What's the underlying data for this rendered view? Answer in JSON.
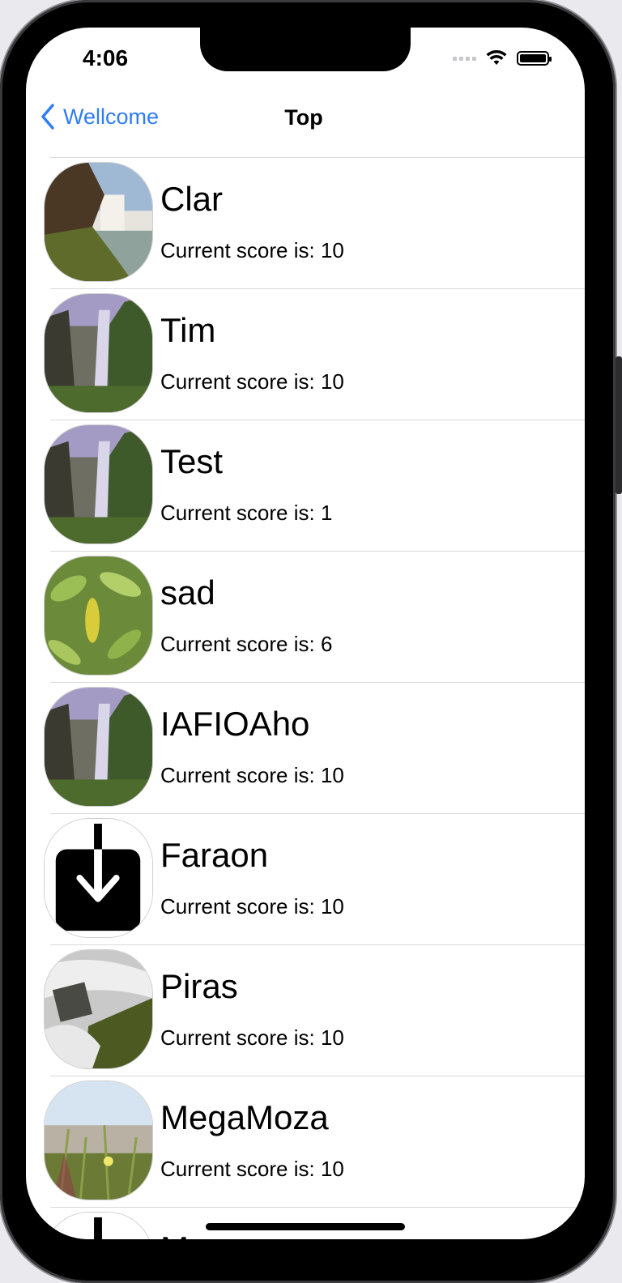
{
  "status_bar": {
    "time": "4:06"
  },
  "nav": {
    "back_label": "Wellcome",
    "title": "Top"
  },
  "players": [
    {
      "name": "Clar",
      "score": "Current score is: 10",
      "avatar": "cliff-waterfall-photo"
    },
    {
      "name": "Tim",
      "score": "Current score is: 10",
      "avatar": "waterfall-photo"
    },
    {
      "name": "Test",
      "score": "Current score is: 1",
      "avatar": "waterfall-photo"
    },
    {
      "name": "sad",
      "score": "Current score is: 6",
      "avatar": "leaves-photo"
    },
    {
      "name": "IAFIOAho",
      "score": "Current score is: 10",
      "avatar": "waterfall-photo"
    },
    {
      "name": "Faraon",
      "score": "Current score is: 10",
      "avatar": "download-icon"
    },
    {
      "name": "Piras",
      "score": "Current score is: 10",
      "avatar": "stream-rocks-photo"
    },
    {
      "name": "MegaMoza",
      "score": "Current score is: 10",
      "avatar": "meadow-photo"
    },
    {
      "name": "M",
      "score": "",
      "avatar": "download-icon"
    }
  ],
  "colors": {
    "accent": "#2f7cf6",
    "separator": "#d9d9dd"
  }
}
